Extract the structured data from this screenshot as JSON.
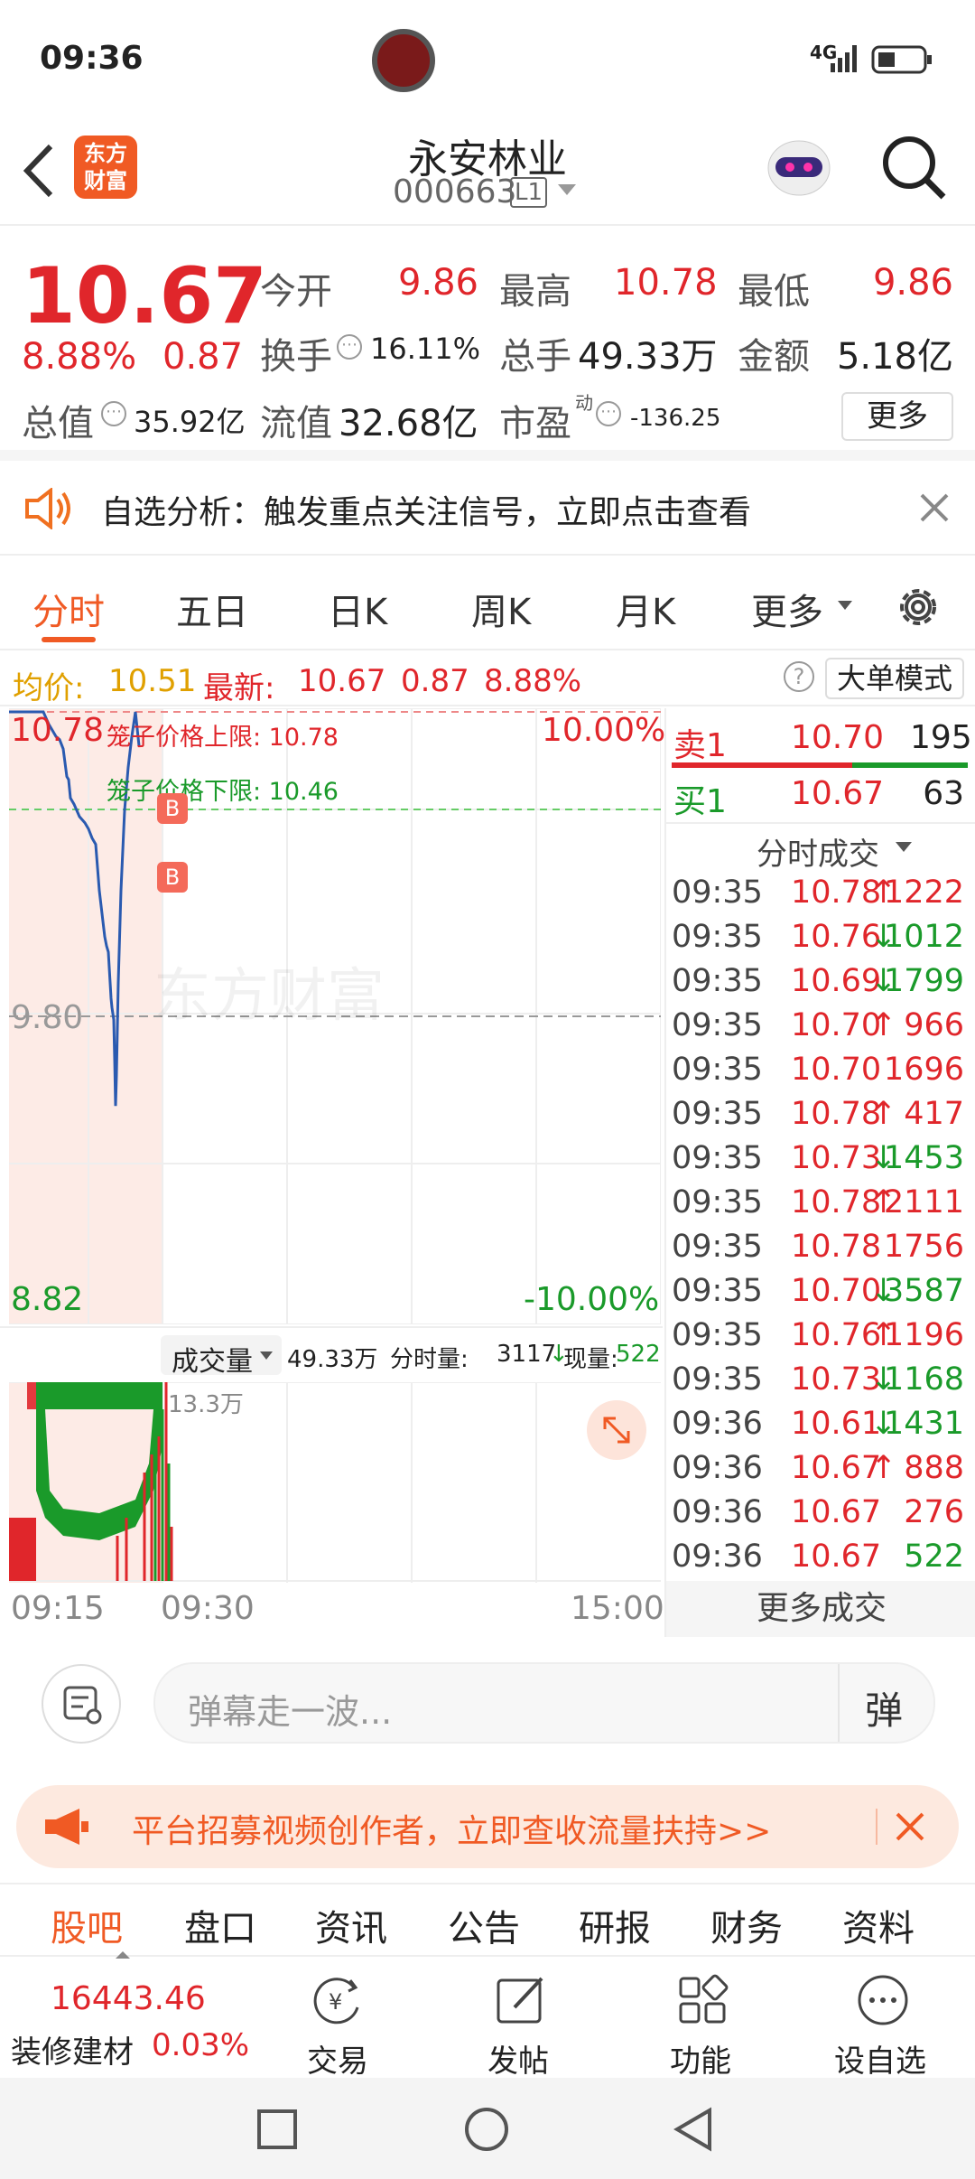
{
  "status_bar": {
    "time": "09:36",
    "network": "4G"
  },
  "header": {
    "logo_text": "东方财富",
    "stock_name": "永安林业",
    "stock_code": "000663",
    "level_badge": "L1"
  },
  "quote": {
    "price": "10.67",
    "change_pct": "8.88%",
    "change_amt": "0.87",
    "open_label": "今开",
    "open": "9.86",
    "high_label": "最高",
    "high": "10.78",
    "low_label": "最低",
    "low": "9.86",
    "turnover_label": "换手",
    "turnover": "16.11%",
    "volume_label": "总手",
    "volume": "49.33万",
    "amount_label": "金额",
    "amount": "5.18亿",
    "mcap_label": "总值",
    "mcap": "35.92亿",
    "float_label": "流值",
    "float_mcap": "32.68亿",
    "pe_label": "市盈",
    "pe_sup": "动",
    "pe": "-136.25",
    "more_button": "更多"
  },
  "notice": {
    "text": "自选分析：触发重点关注信号，立即点击查看"
  },
  "chart_tabs": [
    "分时",
    "五日",
    "日K",
    "周K",
    "月K",
    "更多"
  ],
  "chart_info": {
    "avg_label": "均价:",
    "avg": "10.51",
    "latest_label": "最新:",
    "latest": "10.67",
    "chg": "0.87",
    "pct": "8.88%",
    "mode_button": "大单模式"
  },
  "chart_data": {
    "type": "line",
    "y_top": "10.78",
    "y_mid": "9.80",
    "y_bottom": "8.82",
    "pct_top": "10.00%",
    "pct_bottom": "-10.00%",
    "cage_upper_label": "笼子价格上限: 10.78",
    "cage_lower_label": "笼子价格下限: 10.46",
    "ylim": [
      8.82,
      10.78
    ],
    "series": [
      {
        "values": [
          10.78,
          10.78,
          10.78,
          10.74,
          10.72,
          10.7,
          10.69,
          10.66,
          10.57,
          10.56,
          10.5,
          10.48,
          10.44,
          10.42,
          10.4,
          10.37,
          10.35,
          10.2,
          10.1,
          10.05,
          10.02,
          10.0,
          9.95,
          9.9,
          9.85,
          9.82,
          9.8,
          9.78,
          9.65,
          9.5,
          9.6,
          9.9,
          10.2,
          10.46,
          10.6,
          10.7,
          10.78,
          10.67
        ]
      }
    ],
    "markers": [
      "B",
      "B"
    ]
  },
  "volume": {
    "label": "成交量",
    "total": "49.33万",
    "fenshi_label": "分时量:",
    "fenshi_value": "3117",
    "now_label": "现量:",
    "now_value": "522",
    "max_label": "13.3万",
    "t_start": "09:15",
    "t_mid": "09:30",
    "t_end": "15:00"
  },
  "order_book": [
    {
      "label": "卖1",
      "price": "10.70",
      "vol": "195"
    },
    {
      "label": "买1",
      "price": "10.67",
      "vol": "63"
    }
  ],
  "trades_title": "分时成交",
  "trades": [
    {
      "t": "09:35",
      "p": "10.78",
      "d": "↑",
      "v": "1222",
      "c": "red"
    },
    {
      "t": "09:35",
      "p": "10.76",
      "d": "↓",
      "v": "1012",
      "c": "green"
    },
    {
      "t": "09:35",
      "p": "10.69",
      "d": "↓",
      "v": "1799",
      "c": "green"
    },
    {
      "t": "09:35",
      "p": "10.70",
      "d": "↑",
      "v": "966",
      "c": "red"
    },
    {
      "t": "09:35",
      "p": "10.70",
      "d": "",
      "v": "1696",
      "c": "red"
    },
    {
      "t": "09:35",
      "p": "10.78",
      "d": "↑",
      "v": "417",
      "c": "red"
    },
    {
      "t": "09:35",
      "p": "10.73",
      "d": "↓",
      "v": "1453",
      "c": "green"
    },
    {
      "t": "09:35",
      "p": "10.78",
      "d": "↑",
      "v": "2111",
      "c": "red"
    },
    {
      "t": "09:35",
      "p": "10.78",
      "d": "",
      "v": "1756",
      "c": "red"
    },
    {
      "t": "09:35",
      "p": "10.70",
      "d": "↓",
      "v": "3587",
      "c": "green"
    },
    {
      "t": "09:35",
      "p": "10.76",
      "d": "↑",
      "v": "1196",
      "c": "red"
    },
    {
      "t": "09:35",
      "p": "10.73",
      "d": "↓",
      "v": "1168",
      "c": "green"
    },
    {
      "t": "09:36",
      "p": "10.61",
      "d": "↓",
      "v": "1431",
      "c": "green"
    },
    {
      "t": "09:36",
      "p": "10.67",
      "d": "↑",
      "v": "888",
      "c": "red"
    },
    {
      "t": "09:36",
      "p": "10.67",
      "d": "",
      "v": "276",
      "c": "red"
    },
    {
      "t": "09:36",
      "p": "10.67",
      "d": "",
      "v": "522",
      "c": "green"
    }
  ],
  "more_trades": "更多成交",
  "danmu": {
    "placeholder": "弹幕走一波...",
    "send": "弹"
  },
  "promo": {
    "text": "平台招募视频创作者，立即查收流量扶持>>"
  },
  "bottom_tabs": [
    "股吧",
    "盘口",
    "资讯",
    "公告",
    "研报",
    "财务",
    "资料"
  ],
  "footer": {
    "index_value": "16443.46",
    "sector": "装修建材",
    "sector_pct": "0.03%",
    "trade": "交易",
    "post": "发帖",
    "func": "功能",
    "watch": "设自选"
  }
}
